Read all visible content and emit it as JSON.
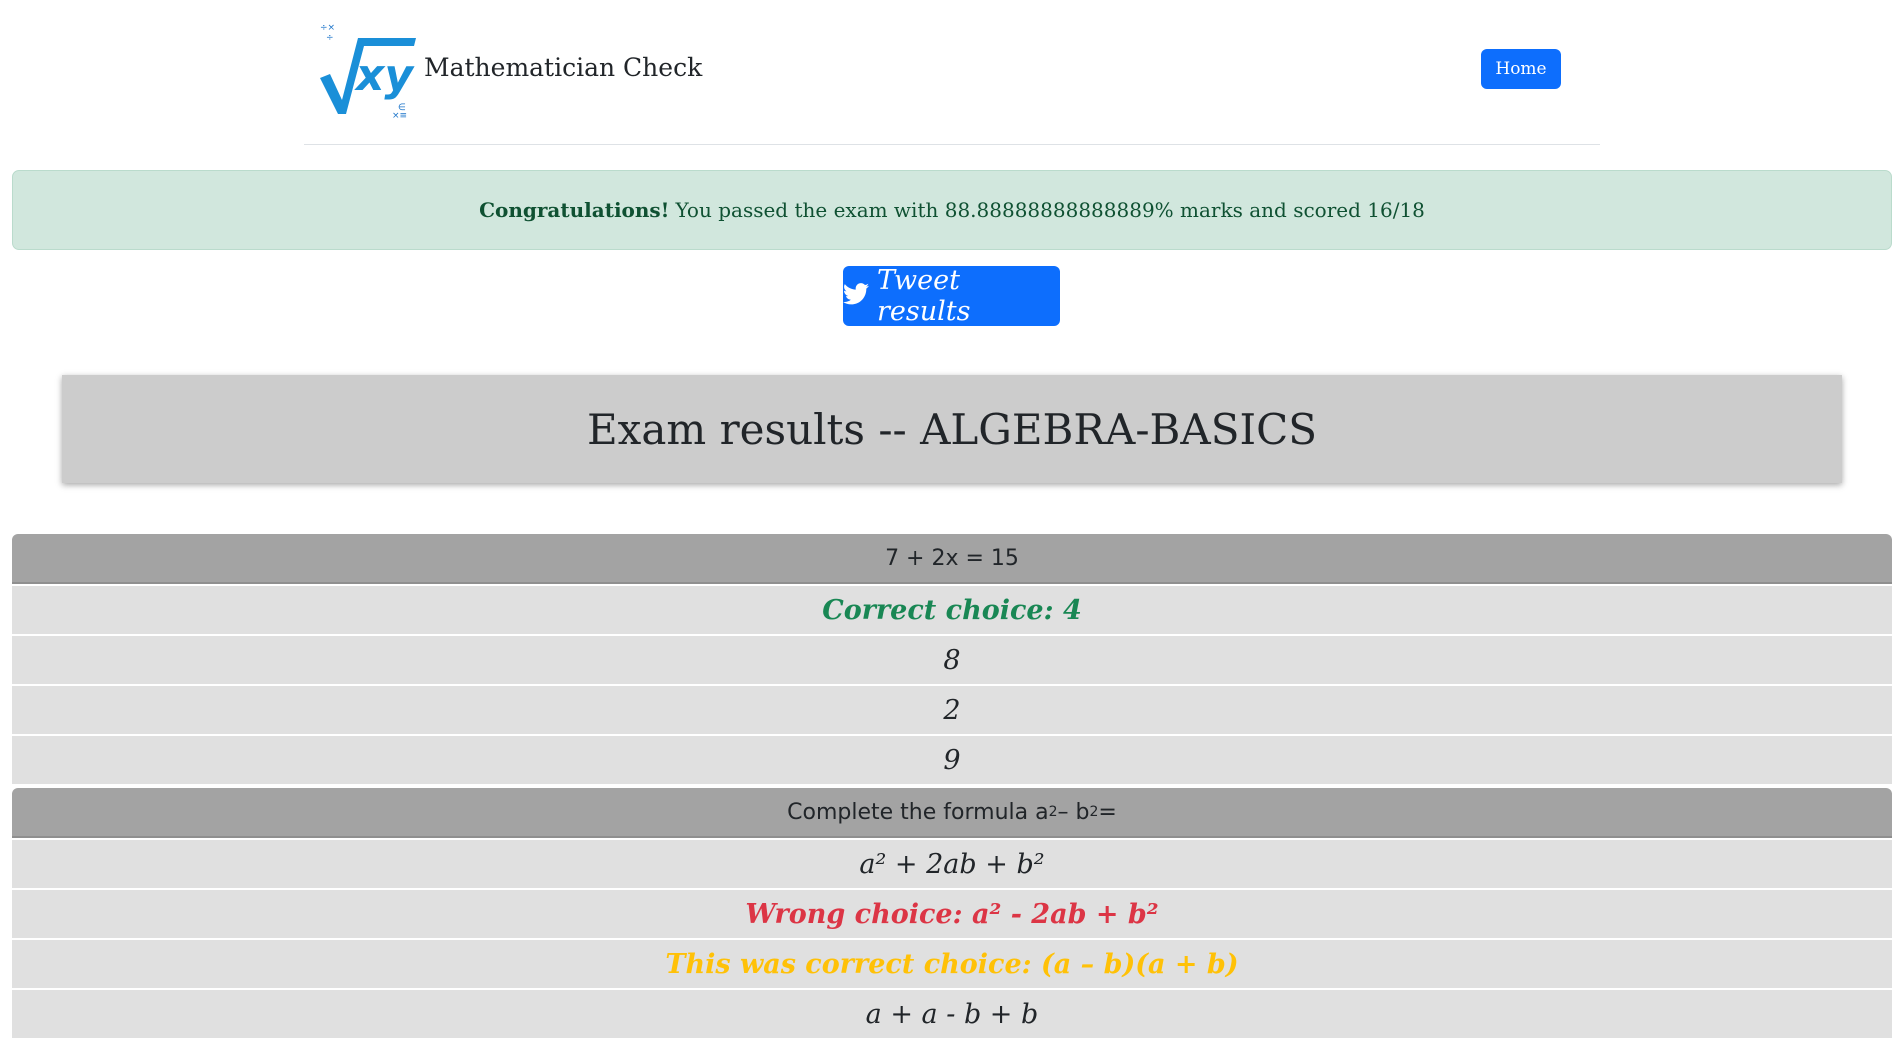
{
  "header": {
    "brand_name": "Mathematician Check",
    "home_label": "Home",
    "logo_icon": "sqrt-xy-logo"
  },
  "alert": {
    "strong": "Congratulations!",
    "message": "You passed the exam with 88.88888888888889% marks and scored 16/18"
  },
  "tweet": {
    "label": "Tweet results",
    "icon": "twitter-bird-icon"
  },
  "exam_title": "Exam results -- ALGEBRA-BASICS",
  "colors": {
    "primary": "#0d6efd",
    "correct": "#198754",
    "wrong": "#dc3545",
    "missed": "#ffc107",
    "alert_bg": "#d1e7dd"
  },
  "questions": [
    {
      "question": "7 + 2x = 15",
      "choices": [
        {
          "text": "Correct choice: 4",
          "status": "correct"
        },
        {
          "text": "8",
          "status": "none"
        },
        {
          "text": "2",
          "status": "none"
        },
        {
          "text": "9",
          "status": "none"
        }
      ]
    },
    {
      "question_prefix": "Complete the formula a",
      "question_mid": " – b",
      "question_suffix": " =",
      "choices": [
        {
          "text": "a² + 2ab + b²",
          "status": "none"
        },
        {
          "text": "Wrong choice: a² - 2ab + b²",
          "status": "wrong"
        },
        {
          "text": "This was correct choice: (a – b)(a + b)",
          "status": "missed"
        },
        {
          "text": "a + a - b + b",
          "status": "none"
        }
      ]
    }
  ]
}
